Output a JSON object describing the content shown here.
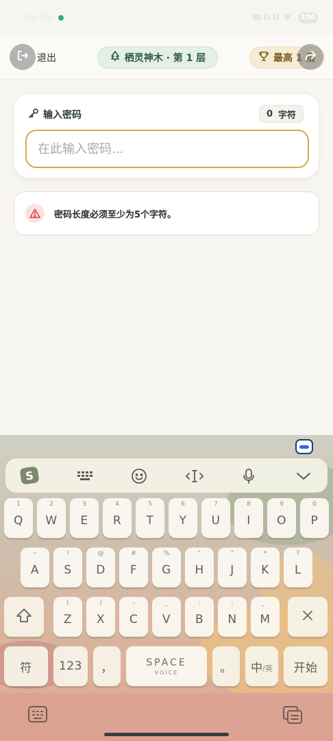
{
  "status": {
    "time": "14:24",
    "battery": "100"
  },
  "header": {
    "exit_label": "退出",
    "level_label": "栖灵神木 · 第 1 层",
    "best_label": "最高 1 层"
  },
  "password": {
    "title": "输入密码",
    "char_count": "0",
    "char_unit": "字符",
    "placeholder": "在此输入密码...",
    "value": ""
  },
  "error": {
    "message": "密码长度必须至少为5个字符。"
  },
  "keyboard": {
    "row1": [
      {
        "sub": "1",
        "main": "Q"
      },
      {
        "sub": "2",
        "main": "W"
      },
      {
        "sub": "3",
        "main": "E"
      },
      {
        "sub": "4",
        "main": "R"
      },
      {
        "sub": "5",
        "main": "T"
      },
      {
        "sub": "6",
        "main": "Y"
      },
      {
        "sub": "7",
        "main": "U"
      },
      {
        "sub": "8",
        "main": "I"
      },
      {
        "sub": "9",
        "main": "O"
      },
      {
        "sub": "0",
        "main": "P"
      }
    ],
    "row2": [
      {
        "sub": "~",
        "main": "A"
      },
      {
        "sub": "!",
        "main": "S"
      },
      {
        "sub": "@",
        "main": "D"
      },
      {
        "sub": "#",
        "main": "F"
      },
      {
        "sub": "%",
        "main": "G"
      },
      {
        "sub": "“",
        "main": "H"
      },
      {
        "sub": "”",
        "main": "J"
      },
      {
        "sub": "*",
        "main": "K"
      },
      {
        "sub": "?",
        "main": "L"
      }
    ],
    "row3": [
      {
        "sub": "(",
        "main": "Z"
      },
      {
        "sub": ")",
        "main": "X"
      },
      {
        "sub": "-",
        "main": "C"
      },
      {
        "sub": "_",
        "main": "V"
      },
      {
        "sub": ":",
        "main": "B"
      },
      {
        "sub": ";",
        "main": "N"
      },
      {
        "sub": "、",
        "main": "M"
      }
    ],
    "symbol_key": "符",
    "number_key": "123",
    "comma_key": "，",
    "space_main": "SPACE",
    "space_sub": "VOICE",
    "period_key": "。",
    "lang_key": "中",
    "lang_sub": "/英",
    "enter_key": "开始"
  }
}
